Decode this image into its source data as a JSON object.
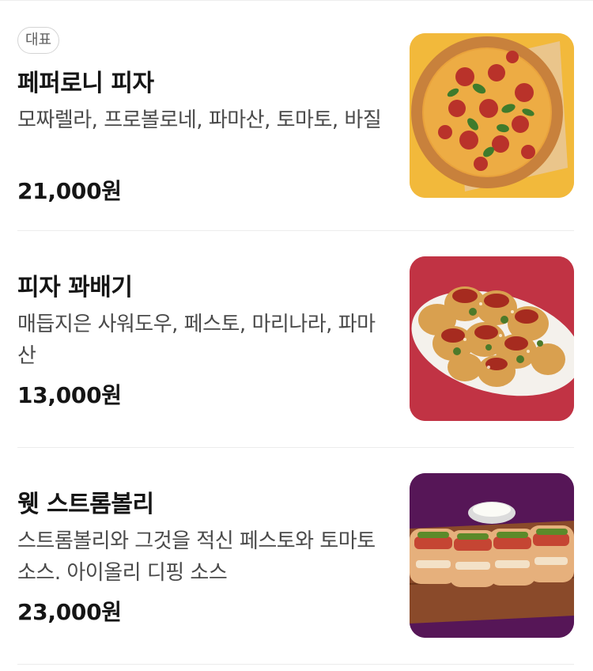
{
  "menu": {
    "items": [
      {
        "badge": "대표",
        "name": "페퍼로니 피자",
        "desc": "모짜렐라, 프로볼로네, 파마산, 토마토, 바질",
        "price": "21,000원",
        "image": "pepperoni-pizza-photo",
        "bg": "#f2b93b"
      },
      {
        "name": "피자 꽈배기",
        "desc": "매듭지은 사워도우, 페스토, 마리나라, 파마산",
        "price": "13,000원",
        "image": "pizza-knots-photo",
        "bg": "#c13344"
      },
      {
        "name": "웻 스트롬볼리",
        "desc": "스트롬볼리와 그것을 적신 페스토와 토마토소스. 아이올리 디핑 소스",
        "price": "23,000원",
        "image": "wet-stromboli-photo",
        "bg": "#561657"
      }
    ]
  }
}
